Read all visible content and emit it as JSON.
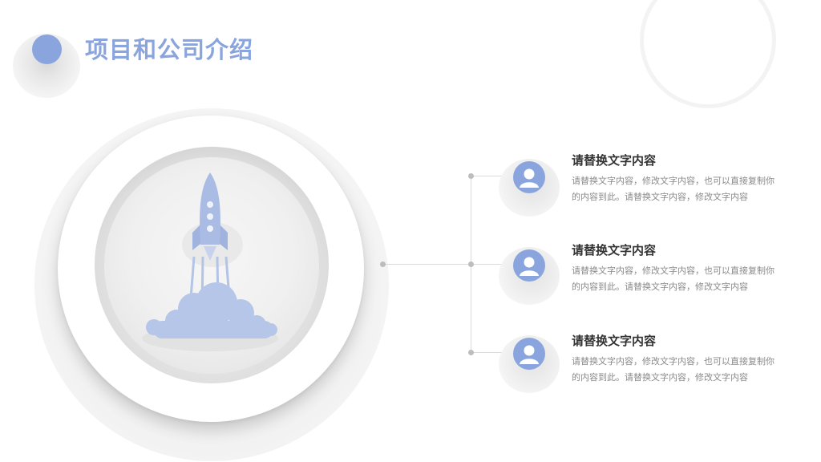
{
  "slide": {
    "title": "项目和公司介绍",
    "accent_color": "#8aa5de",
    "illustration_icon": "rocket-launch-icon"
  },
  "items": [
    {
      "heading": "请替换文字内容",
      "body": "请替换文字内容，修改文字内容，也可以直接复制你的内容到此。请替换文字内容，修改文字内容",
      "icon": "user-avatar-icon"
    },
    {
      "heading": "请替换文字内容",
      "body": "请替换文字内容，修改文字内容，也可以直接复制你的内容到此。请替换文字内容，修改文字内容",
      "icon": "user-avatar-icon"
    },
    {
      "heading": "请替换文字内容",
      "body": "请替换文字内容，修改文字内容，也可以直接复制你的内容到此。请替换文字内容，修改文字内容",
      "icon": "user-avatar-icon"
    }
  ]
}
